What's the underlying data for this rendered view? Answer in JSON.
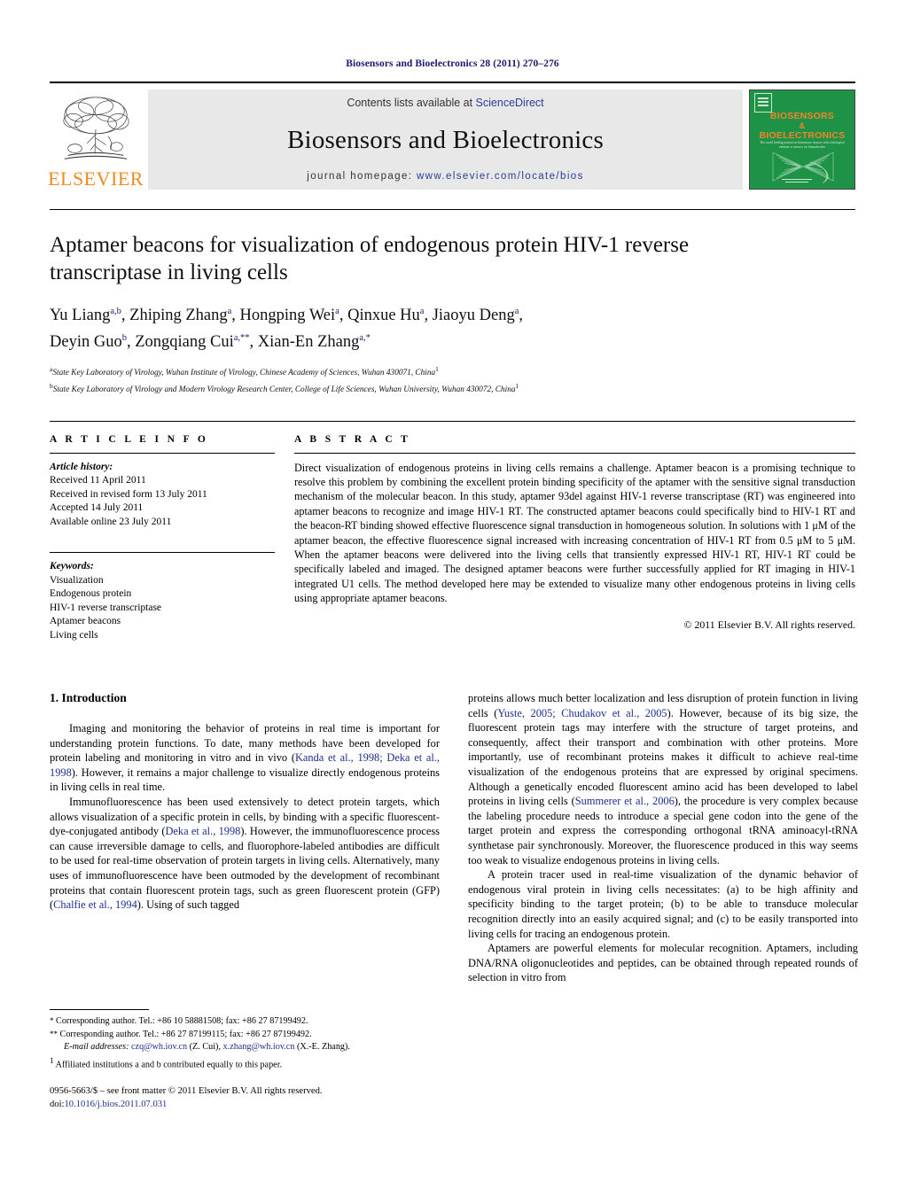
{
  "running_head": "Biosensors and Bioelectronics 28 (2011) 270–276",
  "masthead": {
    "contents_prefix": "Contents lists available at ",
    "sciencedirect": "ScienceDirect",
    "journal_title": "Biosensors and Bioelectronics",
    "homepage_prefix": "journal homepage: ",
    "homepage_url": "www.elsevier.com/locate/bios",
    "publisher": "ELSEVIER",
    "cover": {
      "line1": "BIOSENSORS",
      "amp": "&",
      "line2": "BIOELECTRONICS",
      "subtitle": "The world leading journal on biosensors: sensors with a biological element or sensors for biomolecules"
    }
  },
  "article": {
    "title": "Aptamer beacons for visualization of endogenous protein HIV-1 reverse transcriptase in living cells",
    "authors_line1_names": [
      {
        "name": "Yu Liang",
        "sup": "a,b"
      },
      {
        "name": "Zhiping Zhang",
        "sup": "a"
      },
      {
        "name": "Hongping Wei",
        "sup": "a"
      },
      {
        "name": "Qinxue Hu",
        "sup": "a"
      },
      {
        "name": "Jiaoyu Deng",
        "sup": "a"
      }
    ],
    "authors_line2_names": [
      {
        "name": "Deyin Guo",
        "sup": "b"
      },
      {
        "name": "Zongqiang Cui",
        "sup": "a,**"
      },
      {
        "name": "Xian-En Zhang",
        "sup": "a,*"
      }
    ],
    "affiliations": [
      {
        "mark": "a",
        "text": "State Key Laboratory of Virology, Wuhan Institute of Virology, Chinese Academy of Sciences, Wuhan 430071, China",
        "footmark": "1"
      },
      {
        "mark": "b",
        "text": "State Key Laboratory of Virology and Modern Virology Research Center, College of Life Sciences, Wuhan University, Wuhan 430072, China",
        "footmark": "1"
      }
    ]
  },
  "article_info": {
    "heading": "A R T I C L E    I N F O",
    "history_label": "Article history:",
    "history": [
      "Received 11 April 2011",
      "Received in revised form 13 July 2011",
      "Accepted 14 July 2011",
      "Available online 23 July 2011"
    ],
    "keywords_label": "Keywords:",
    "keywords": [
      "Visualization",
      "Endogenous protein",
      "HIV-1 reverse transcriptase",
      "Aptamer beacons",
      "Living cells"
    ]
  },
  "abstract": {
    "heading": "A B S T R A C T",
    "text": "Direct visualization of endogenous proteins in living cells remains a challenge. Aptamer beacon is a promising technique to resolve this problem by combining the excellent protein binding specificity of the aptamer with the sensitive signal transduction mechanism of the molecular beacon. In this study, aptamer 93del against HIV-1 reverse transcriptase (RT) was engineered into aptamer beacons to recognize and image HIV-1 RT. The constructed aptamer beacons could specifically bind to HIV-1 RT and the beacon-RT binding showed effective fluorescence signal transduction in homogeneous solution. In solutions with 1 μM of the aptamer beacon, the effective fluorescence signal increased with increasing concentration of HIV-1 RT from 0.5 μM to 5 μM. When the aptamer beacons were delivered into the living cells that transiently expressed HIV-1 RT, HIV-1 RT could be specifically labeled and imaged. The designed aptamer beacons were further successfully applied for RT imaging in HIV-1 integrated U1 cells. The method developed here may be extended to visualize many other endogenous proteins in living cells using appropriate aptamer beacons.",
    "copyright": "© 2011 Elsevier B.V. All rights reserved."
  },
  "body": {
    "section_heading": "1.  Introduction",
    "left_paragraphs": [
      {
        "segments": [
          {
            "t": "Imaging and monitoring the behavior of proteins in real time is important for understanding protein functions. To date, many methods have been developed for protein labeling and monitoring in vitro and in vivo ("
          },
          {
            "t": "Kanda et al., 1998; Deka et al., 1998",
            "cite": true
          },
          {
            "t": "). However, it remains a major challenge to visualize directly endogenous proteins in living cells in real time."
          }
        ]
      },
      {
        "segments": [
          {
            "t": "Immunofluorescence has been used extensively to detect protein targets, which allows visualization of a specific protein in cells, by binding with a specific fluorescent-dye-conjugated antibody ("
          },
          {
            "t": "Deka et al., 1998",
            "cite": true
          },
          {
            "t": "). However, the immunofluorescence process can cause irreversible damage to cells, and fluorophore-labeled antibodies are difficult to be used for real-time observation of protein targets in living cells. Alternatively, many uses of immunofluorescence have been outmoded by the development of recombinant proteins that contain fluorescent protein tags, such as green fluorescent protein (GFP) ("
          },
          {
            "t": "Chalfie et al., 1994",
            "cite": true
          },
          {
            "t": "). Using of such tagged"
          }
        ]
      }
    ],
    "right_paragraphs": [
      {
        "noindent": true,
        "segments": [
          {
            "t": "proteins allows much better localization and less disruption of protein function in living cells ("
          },
          {
            "t": "Yuste, 2005; Chudakov et al., 2005",
            "cite": true
          },
          {
            "t": "). However, because of its big size, the fluorescent protein tags may interfere with the structure of target proteins, and consequently, affect their transport and combination with other proteins. More importantly, use of recombinant proteins makes it difficult to achieve real-time visualization of the endogenous proteins that are expressed by original specimens. Although a genetically encoded fluorescent amino acid has been developed to label proteins in living cells ("
          },
          {
            "t": "Summerer et al., 2006",
            "cite": true
          },
          {
            "t": "), the procedure is very complex because the labeling procedure needs to introduce a special gene codon into the gene of the target protein and express the corresponding orthogonal tRNA aminoacyl-tRNA synthetase pair synchronously. Moreover, the fluorescence produced in this way seems too weak to visualize endogenous proteins in living cells."
          }
        ]
      },
      {
        "segments": [
          {
            "t": "A protein tracer used in real-time visualization of the dynamic behavior of endogenous viral protein in living cells necessitates: (a) to be high affinity and specificity binding to the target protein; (b) to be able to transduce molecular recognition directly into an easily acquired signal; and (c) to be easily transported into living cells for tracing an endogenous protein."
          }
        ]
      },
      {
        "segments": [
          {
            "t": "Aptamers are powerful elements for molecular recognition. Aptamers, including DNA/RNA oligonucleotides and peptides, can be obtained through repeated rounds of selection in vitro from"
          }
        ]
      }
    ]
  },
  "footnotes": {
    "corresponding_1": "Corresponding author. Tel.: +86 10 58881508; fax: +86 27 87199492.",
    "corresponding_1_mark": "*",
    "corresponding_2": "Corresponding author. Tel.: +86 27 87199115; fax: +86 27 87199492.",
    "corresponding_2_mark": "**",
    "email_label": "E-mail addresses:",
    "email_1": "czq@wh.iov.cn",
    "email_1_owner": "(Z. Cui),",
    "email_2": "x.zhang@wh.iov.cn",
    "email_2_owner": "(X.-E. Zhang).",
    "affil_note_mark": "1",
    "affil_note": "Affiliated institutions a and b contributed equally to this paper.",
    "issn_line": "0956-5663/$ – see front matter © 2011 Elsevier B.V. All rights reserved.",
    "doi_label": "doi:",
    "doi_value": "10.1016/j.bios.2011.07.031"
  }
}
